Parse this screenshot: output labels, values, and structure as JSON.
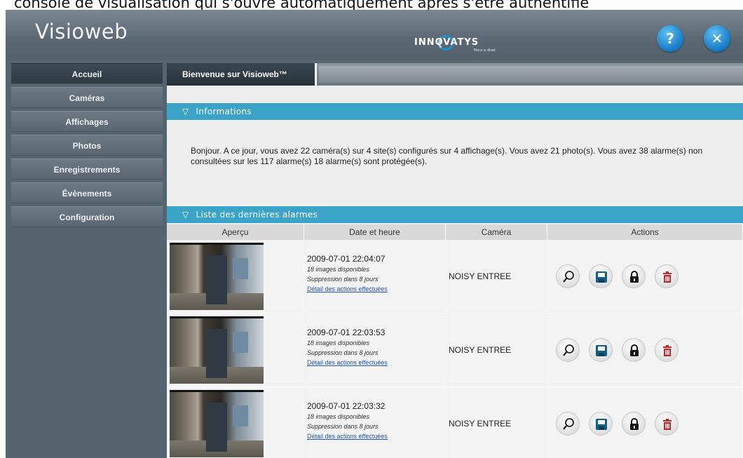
{
  "caption": "console de visualisation qui s'ouvre automatiquement après s'être authentifié",
  "app": {
    "title": "Visioweb",
    "logo_text": "INNOVATYS",
    "logo_tagline": "Nous a diset",
    "help_label": "?",
    "close_label": "✕"
  },
  "sidebar": {
    "items": [
      {
        "label": "Accueil"
      },
      {
        "label": "Caméras"
      },
      {
        "label": "Affichages"
      },
      {
        "label": "Photos"
      },
      {
        "label": "Enregistrements"
      },
      {
        "label": "Évènements"
      },
      {
        "label": "Configuration"
      }
    ]
  },
  "main": {
    "tab_label": "Bienvenue sur Visioweb™",
    "info_section": {
      "title": "Informations",
      "text": "Bonjour. A ce jour, vous avez 22 caméra(s) sur 4 site(s) configurés sur 4 affichage(s). Vous avez 21 photo(s). Vous avez 38 alarme(s) non consultées sur les 117 alarme(s) 18 alarme(s) sont protégée(s)."
    },
    "alarms_section": {
      "title": "Liste des dernières alarmes",
      "columns": [
        "Aperçu",
        "Date et heure",
        "Caméra",
        "Actions"
      ],
      "rows": [
        {
          "datetime": "2009-07-01 22:04:07",
          "images": "18 images disponibles",
          "deletion": "Suppression dans 8 jours",
          "detail": "Détail des actions effectuées",
          "camera": "NOISY ENTREE"
        },
        {
          "datetime": "2009-07-01 22:03:53",
          "images": "18 images disponibles",
          "deletion": "Suppression dans 8 jours",
          "detail": "Détail des actions effectuées",
          "camera": "NOISY ENTREE"
        },
        {
          "datetime": "2009-07-01 22:03:32",
          "images": "18 images disponibles",
          "deletion": "Suppression dans 8 jours",
          "detail": "Détail des actions effectuées",
          "camera": "NOISY ENTREE"
        }
      ]
    }
  },
  "icons": {
    "view": "magnifier-icon",
    "save": "floppy-disk-icon",
    "protect": "padlock-icon",
    "delete": "trash-icon"
  },
  "colors": {
    "section_bar": "#3aa3c7",
    "app_bg": "#56646f",
    "accent_button": "#1679c4",
    "delete_icon": "#c0282a",
    "save_icon": "#0f5f86"
  }
}
